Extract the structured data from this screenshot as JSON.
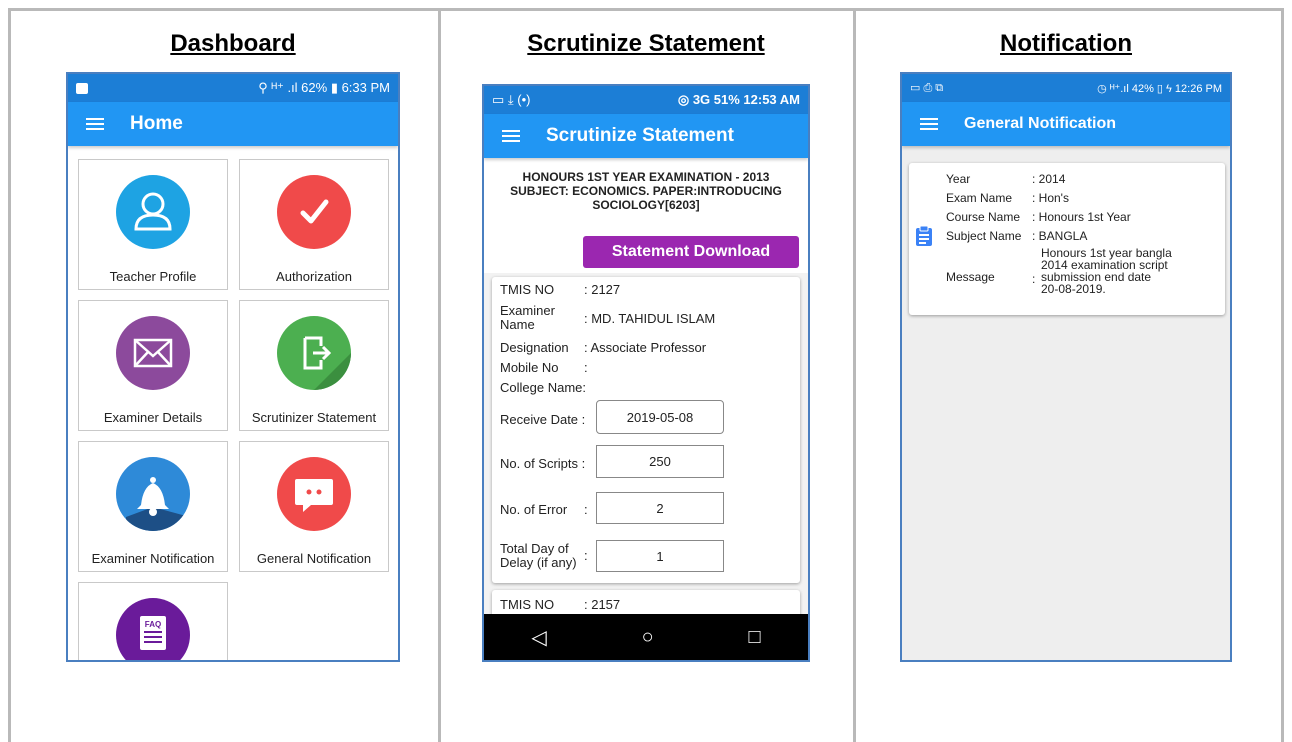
{
  "columns": {
    "dashboard": "Dashboard",
    "scrutinize": "Scrutinize Statement",
    "notification": "Notification"
  },
  "colors": {
    "primary": "#2196f3",
    "purple": "#9b27b0",
    "divider": "#b9b9b9"
  },
  "dashboard": {
    "status": {
      "right": "⚲ ᴴ⁺ .ıl 62% ▮ 6:33 PM"
    },
    "appbar_title": "Home",
    "tiles": [
      {
        "label": "Teacher Profile",
        "icon": "user-icon",
        "color": "#1ea3e3"
      },
      {
        "label": "Authorization",
        "icon": "check-icon",
        "color": "#f04a4a"
      },
      {
        "label": "Examiner Details",
        "icon": "envelope-icon",
        "color": "#8c4a9c"
      },
      {
        "label": "Scrutinizer Statement",
        "icon": "export-file-icon",
        "color": "#4caf50"
      },
      {
        "label": "Examiner Notification",
        "icon": "bell-icon",
        "color": "#2e8ad8"
      },
      {
        "label": "General Notification",
        "icon": "chat-bubble-icon",
        "color": "#f04a4a"
      },
      {
        "label": "FAQ",
        "icon": "faq-icon",
        "color": "#6a1b9a"
      }
    ]
  },
  "scrutinize": {
    "status": {
      "left": "▭ ⤓ (•)",
      "right": "◎ 3G 51% 12:53 AM"
    },
    "appbar_title": "Scrutinize Statement",
    "header_lines": [
      "HONOURS 1ST YEAR EXAMINATION - 2013",
      "SUBJECT: ECONOMICS. PAPER:INTRODUCING",
      "SOCIOLOGY[6203]"
    ],
    "download_button": "Statement Download",
    "card1": {
      "tmis_label": "TMIS NO",
      "tmis_value": ": 2127",
      "examiner_label_1": "Examiner",
      "examiner_label_2": "Name",
      "examiner_value": ": MD. TAHIDUL ISLAM",
      "designation_label": "Designation",
      "designation_value": ": Associate Professor",
      "mobile_label": "Mobile No",
      "mobile_value": ":",
      "college_label": "College Name:",
      "receive_label": "Receive Date :",
      "receive_value": "2019-05-08",
      "scripts_label": "No. of Scripts :",
      "scripts_value": "250",
      "error_label": "No. of Error",
      "error_colon": ":",
      "error_value": "2",
      "delay_label_1": "Total Day of",
      "delay_label_2": "Delay (if any)",
      "delay_colon": ":",
      "delay_value": "1"
    },
    "card2": {
      "tmis_label": "TMIS NO",
      "tmis_value": ": 2157"
    },
    "nav": {
      "back": "◁",
      "home": "○",
      "recent": "□"
    }
  },
  "notification": {
    "status": {
      "left": "▭ ⎙ ⧉",
      "right": "◷ ᴴ⁺.ıl 42% ▯ ϟ 12:26 PM"
    },
    "appbar_title": "General Notification",
    "rows": [
      {
        "label": "Year",
        "value": ": 2014"
      },
      {
        "label": "Exam Name",
        "value": ": Hon's"
      },
      {
        "label": "Course Name",
        "value": ": Honours 1st Year"
      },
      {
        "label": "Subject Name",
        "value": ": BANGLA"
      }
    ],
    "message_label": "Message",
    "message_colon": ":",
    "message_lines": [
      "Honours 1st year  bangla",
      "2014 examination script",
      "submission end date",
      "20-08-2019."
    ]
  }
}
